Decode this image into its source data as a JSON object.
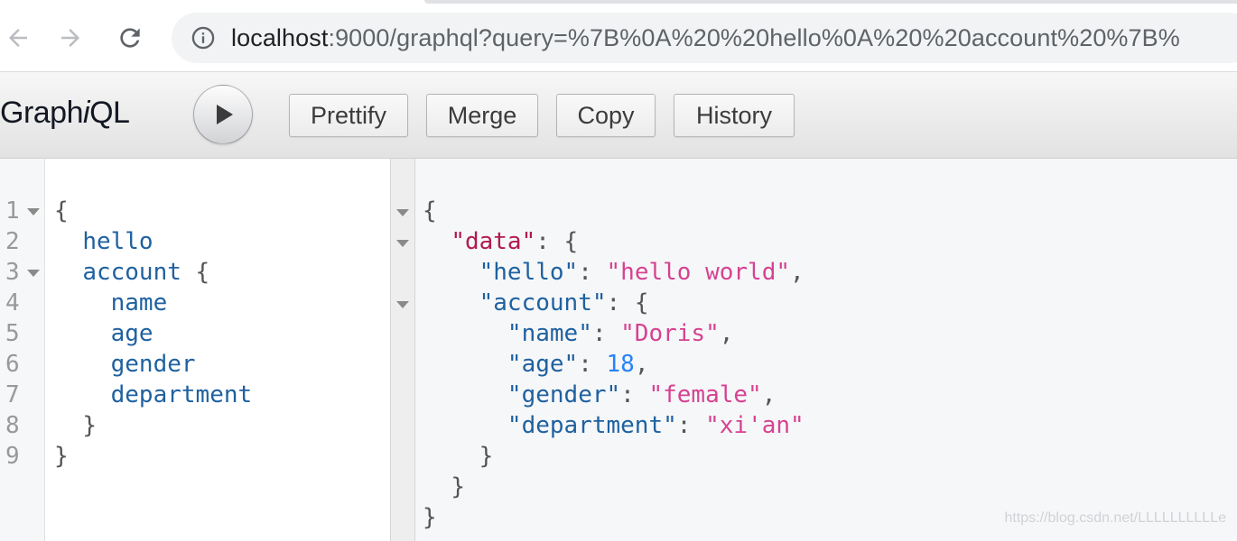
{
  "browser": {
    "url_host": "localhost",
    "url_rest": ":9000/graphql?query=%7B%0A%20%20hello%0A%20%20account%20%7B%"
  },
  "toolbar": {
    "title_prefix": "Graph",
    "title_italic": "i",
    "title_suffix": "QL",
    "run_icon": "play-icon",
    "buttons": {
      "prettify": "Prettify",
      "merge": "Merge",
      "copy": "Copy",
      "history": "History"
    }
  },
  "query_editor": {
    "line_numbers": [
      "1",
      "2",
      "3",
      "4",
      "5",
      "6",
      "7",
      "8",
      "9"
    ],
    "lines": [
      {
        "indent": "",
        "open": "{"
      },
      {
        "indent": "  ",
        "field": "hello"
      },
      {
        "indent": "  ",
        "field": "account",
        "open": " {"
      },
      {
        "indent": "    ",
        "field": "name"
      },
      {
        "indent": "    ",
        "field": "age"
      },
      {
        "indent": "    ",
        "field": "gender"
      },
      {
        "indent": "    ",
        "field": "department"
      },
      {
        "indent": "  ",
        "close": "}"
      },
      {
        "indent": "",
        "close": "}"
      }
    ]
  },
  "result_viewer": {
    "open_root": "{",
    "data_key": "\"data\"",
    "hello_key": "\"hello\"",
    "hello_value": "\"hello world\"",
    "account_key": "\"account\"",
    "name_key": "\"name\"",
    "name_value": "\"Doris\"",
    "age_key": "\"age\"",
    "age_value": "18",
    "gender_key": "\"gender\"",
    "gender_value": "\"female\"",
    "department_key": "\"department\"",
    "department_value": "\"xi'an\"",
    "close_brace": "}"
  },
  "watermark": "https://blog.csdn.net/LLLLLLLLLLe",
  "colors": {
    "field": "#1f61a0",
    "data_key": "#b11a4e",
    "string": "#d64292",
    "number": "#2882f9"
  }
}
